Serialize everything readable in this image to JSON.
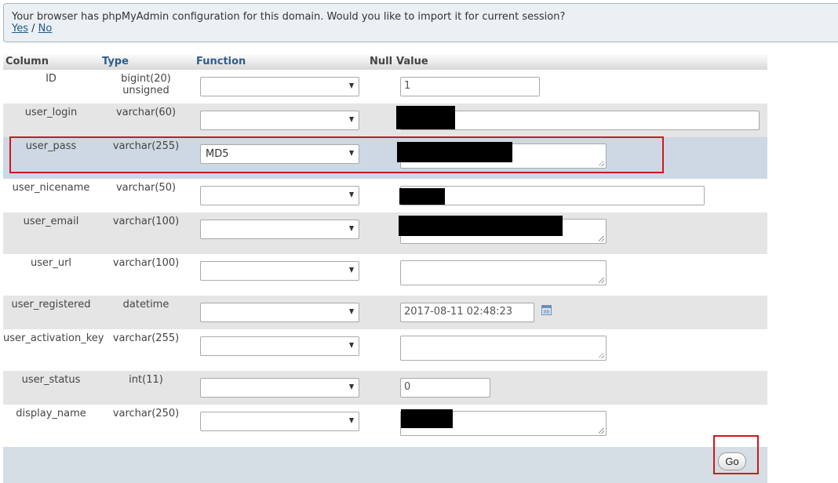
{
  "notice": {
    "text": "Your browser has phpMyAdmin configuration for this domain. Would you like to import it for current session?",
    "yes": "Yes",
    "separator": "/",
    "no": "No"
  },
  "table_header": {
    "column": "Column",
    "type": "Type",
    "function": "Function",
    "null": "Null",
    "value": "Value"
  },
  "rows": [
    {
      "name": "ID",
      "type": "bigint(20) unsigned",
      "function": "",
      "value": "1"
    },
    {
      "name": "user_login",
      "type": "varchar(60)",
      "function": "",
      "value": ""
    },
    {
      "name": "user_pass",
      "type": "varchar(255)",
      "function": "MD5",
      "value": ""
    },
    {
      "name": "user_nicename",
      "type": "varchar(50)",
      "function": "",
      "value": ""
    },
    {
      "name": "user_email",
      "type": "varchar(100)",
      "function": "",
      "value": ""
    },
    {
      "name": "user_url",
      "type": "varchar(100)",
      "function": "",
      "value": ""
    },
    {
      "name": "user_registered",
      "type": "datetime",
      "function": "",
      "value": "2017-08-11 02:48:23"
    },
    {
      "name": "user_activation_key",
      "type": "varchar(255)",
      "function": "",
      "value": ""
    },
    {
      "name": "user_status",
      "type": "int(11)",
      "function": "",
      "value": "0"
    },
    {
      "name": "display_name",
      "type": "varchar(250)",
      "function": "",
      "value": ""
    }
  ],
  "go_button": "Go",
  "icons": {
    "calendar": "calendar-icon",
    "dropdown": "chevron-down-icon"
  },
  "colors": {
    "highlight": "#d2161e",
    "selected_row": "#cdd8e4",
    "link": "#1f5a8a"
  }
}
